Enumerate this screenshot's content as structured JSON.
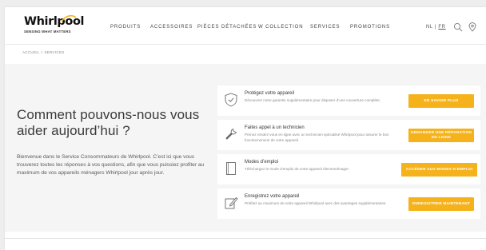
{
  "header": {
    "logo_word": "Whirlpool",
    "logo_tagline": "SENSING WHAT MATTERS",
    "nav": [
      "PRODUITS",
      "ACCESSOIRES",
      "PIÈCES DÉTACHÉES",
      "W COLLECTION",
      "SERVICES",
      "PROMOTIONS"
    ],
    "lang_nl": "NL",
    "lang_sep": " | ",
    "lang_fr": "FR",
    "icons": [
      "search-icon",
      "location-pin-icon"
    ]
  },
  "breadcrumb": {
    "home": "ACCUEIL",
    "sep": " > ",
    "current": "SERVICES"
  },
  "hero": {
    "title": "Comment pouvons-nous vous aider aujourd’hui ?",
    "text": "Bienvenue dans le Service Consommateurs de Whirlpool. C’est ici que vous trouverez toutes les réponses à vos questions, afin que vous puissiez profiter au maximum de vos appareils ménagers Whirlpool jour après jour."
  },
  "cards": [
    {
      "icon": "shield-check-icon",
      "title": "Protégez votre appareil",
      "desc": "Découvrez notre garantie supplémentaire pour disposer d’une couverture complète.",
      "button": "EN SAVOIR PLUS"
    },
    {
      "icon": "wrench-icon",
      "title": "Faites appel à un technicien",
      "desc": "Prenez rendez-vous en ligne avec un technicien spécialisé Whirlpool pour assurer le bon fonctionnement de votre appareil.",
      "button": "DEMANDER UNE RÉPARATION EN LIGNE"
    },
    {
      "icon": "manual-book-icon",
      "title": "Modes d’emploi",
      "desc": "Téléchargez le mode d’emploi de votre appareil électroménager.",
      "button": "ACCÉDER AUX MODES D’EMPLOI"
    },
    {
      "icon": "register-edit-icon",
      "title": "Enregistrez votre appareil",
      "desc": "Profitez au maximum de votre appareil Whirlpool avec des avantages supplémentaires.",
      "button": "ENREGISTRER MAINTENANT"
    }
  ],
  "colors": {
    "accent": "#f5b21b",
    "brand_swoosh": "#f5b21b"
  }
}
